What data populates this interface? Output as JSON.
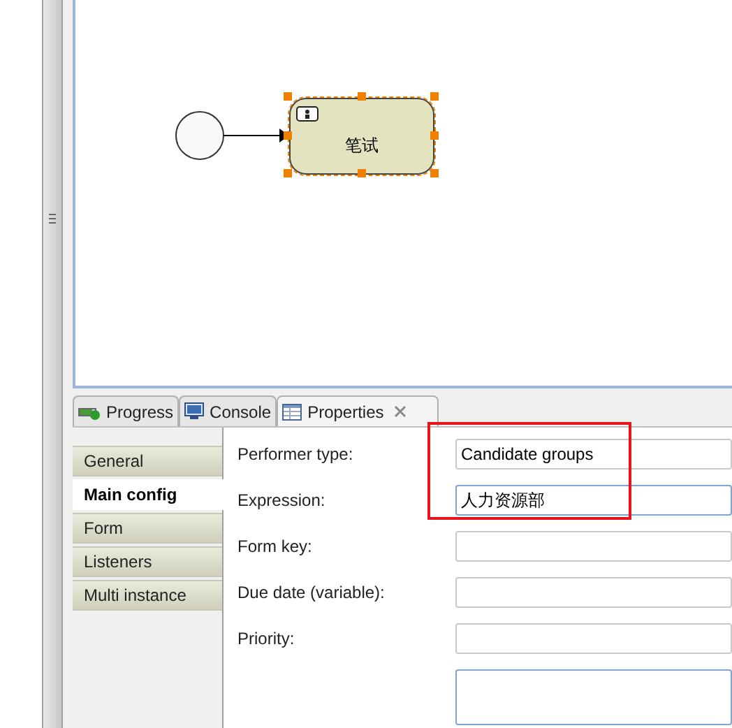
{
  "diagram": {
    "nodes": [
      {
        "kind": "start_event"
      },
      {
        "kind": "user_task",
        "label": "笔试",
        "selected": true
      }
    ]
  },
  "view_tabs": [
    {
      "label": "Progress",
      "kind": "progress",
      "selected": false,
      "closable": false
    },
    {
      "label": "Console",
      "kind": "console",
      "selected": false,
      "closable": false
    },
    {
      "label": "Properties",
      "kind": "properties",
      "selected": true,
      "closable": true
    }
  ],
  "property_tabs": [
    {
      "label": "General",
      "selected": false
    },
    {
      "label": "Main config",
      "selected": true
    },
    {
      "label": "Form",
      "selected": false
    },
    {
      "label": "Listeners",
      "selected": false
    },
    {
      "label": "Multi instance",
      "selected": false
    }
  ],
  "properties": [
    {
      "kind": "text",
      "label": "Performer type:",
      "value": "Candidate groups"
    },
    {
      "kind": "text",
      "label": "Expression:",
      "value": "人力资源部",
      "focused": true
    },
    {
      "kind": "text",
      "label": "Form key:"
    },
    {
      "kind": "text",
      "label": "Due date (variable):"
    },
    {
      "kind": "text",
      "label": "Priority:"
    },
    {
      "kind": "multiline",
      "focused": true
    }
  ]
}
